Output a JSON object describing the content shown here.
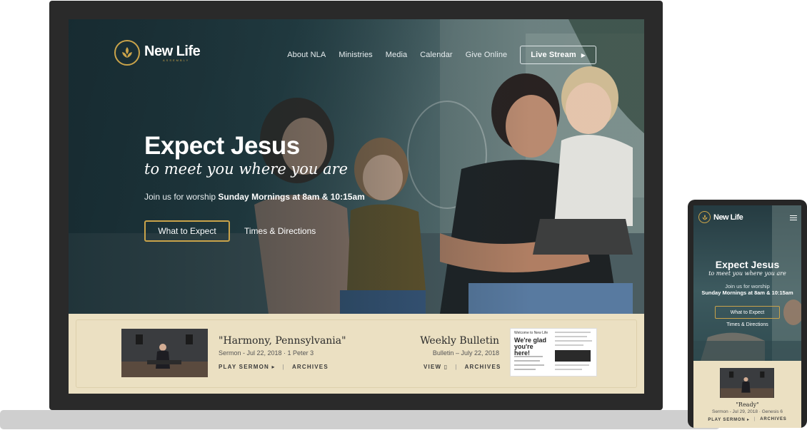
{
  "colors": {
    "accent_gold": "#c9a34a",
    "cream": "#ebe0c2",
    "hero_teal": "#2c4a50",
    "device_frame": "#2a2a2a"
  },
  "brand": {
    "name": "New Life",
    "subtitle": "Assembly",
    "icon": "leaf-flame-icon"
  },
  "nav": {
    "items": [
      "About NLA",
      "Ministries",
      "Media",
      "Calendar",
      "Give Online"
    ],
    "live_stream": "Live Stream",
    "menu_icon": "hamburger-menu-icon"
  },
  "hero": {
    "headline": "Expect Jesus",
    "tagline": "to meet you where you are",
    "join_prefix": "Join us for worship",
    "join_times": "Sunday Mornings at 8am & 10:15am",
    "primary_button": "What to Expect",
    "secondary_link": "Times & Directions"
  },
  "sermon": {
    "title": "\"Harmony, Pennsylvania\"",
    "meta": "Sermon - Jul 22, 2018  ·  1 Peter 3",
    "play": "PLAY SERMON",
    "archives": "ARCHIVES"
  },
  "bulletin": {
    "title": "Weekly Bulletin",
    "meta": "Bulletin – July 22, 2018",
    "view": "VIEW",
    "archives": "ARCHIVES",
    "thumb_heading": "We're glad you're here!",
    "thumb_welcome": "Welcome to New Life"
  },
  "mobile": {
    "headline": "Expect Jesus",
    "tagline": "to meet you where you are",
    "join_prefix": "Join us for worship",
    "join_times": "Sunday Mornings at 8am & 10:15am",
    "primary_button": "What to Expect",
    "secondary_link": "Times & Directions",
    "sermon_title": "\"Ready\"",
    "sermon_meta": "Sermon - Jul 29, 2018  ·  Genesis 6",
    "play": "PLAY SERMON",
    "archives": "ARCHIVES"
  }
}
